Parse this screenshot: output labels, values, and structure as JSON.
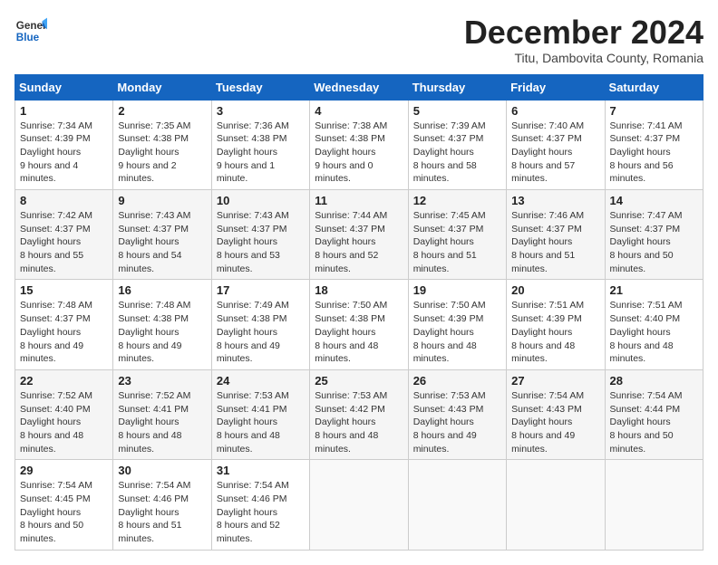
{
  "header": {
    "logo_line1": "General",
    "logo_line2": "Blue",
    "month": "December 2024",
    "location": "Titu, Dambovita County, Romania"
  },
  "columns": [
    "Sunday",
    "Monday",
    "Tuesday",
    "Wednesday",
    "Thursday",
    "Friday",
    "Saturday"
  ],
  "weeks": [
    [
      {
        "day": "1",
        "sunrise": "7:34 AM",
        "sunset": "4:39 PM",
        "daylight": "9 hours and 4 minutes."
      },
      {
        "day": "2",
        "sunrise": "7:35 AM",
        "sunset": "4:38 PM",
        "daylight": "9 hours and 2 minutes."
      },
      {
        "day": "3",
        "sunrise": "7:36 AM",
        "sunset": "4:38 PM",
        "daylight": "9 hours and 1 minute."
      },
      {
        "day": "4",
        "sunrise": "7:38 AM",
        "sunset": "4:38 PM",
        "daylight": "9 hours and 0 minutes."
      },
      {
        "day": "5",
        "sunrise": "7:39 AM",
        "sunset": "4:37 PM",
        "daylight": "8 hours and 58 minutes."
      },
      {
        "day": "6",
        "sunrise": "7:40 AM",
        "sunset": "4:37 PM",
        "daylight": "8 hours and 57 minutes."
      },
      {
        "day": "7",
        "sunrise": "7:41 AM",
        "sunset": "4:37 PM",
        "daylight": "8 hours and 56 minutes."
      }
    ],
    [
      {
        "day": "8",
        "sunrise": "7:42 AM",
        "sunset": "4:37 PM",
        "daylight": "8 hours and 55 minutes."
      },
      {
        "day": "9",
        "sunrise": "7:43 AM",
        "sunset": "4:37 PM",
        "daylight": "8 hours and 54 minutes."
      },
      {
        "day": "10",
        "sunrise": "7:43 AM",
        "sunset": "4:37 PM",
        "daylight": "8 hours and 53 minutes."
      },
      {
        "day": "11",
        "sunrise": "7:44 AM",
        "sunset": "4:37 PM",
        "daylight": "8 hours and 52 minutes."
      },
      {
        "day": "12",
        "sunrise": "7:45 AM",
        "sunset": "4:37 PM",
        "daylight": "8 hours and 51 minutes."
      },
      {
        "day": "13",
        "sunrise": "7:46 AM",
        "sunset": "4:37 PM",
        "daylight": "8 hours and 51 minutes."
      },
      {
        "day": "14",
        "sunrise": "7:47 AM",
        "sunset": "4:37 PM",
        "daylight": "8 hours and 50 minutes."
      }
    ],
    [
      {
        "day": "15",
        "sunrise": "7:48 AM",
        "sunset": "4:37 PM",
        "daylight": "8 hours and 49 minutes."
      },
      {
        "day": "16",
        "sunrise": "7:48 AM",
        "sunset": "4:38 PM",
        "daylight": "8 hours and 49 minutes."
      },
      {
        "day": "17",
        "sunrise": "7:49 AM",
        "sunset": "4:38 PM",
        "daylight": "8 hours and 49 minutes."
      },
      {
        "day": "18",
        "sunrise": "7:50 AM",
        "sunset": "4:38 PM",
        "daylight": "8 hours and 48 minutes."
      },
      {
        "day": "19",
        "sunrise": "7:50 AM",
        "sunset": "4:39 PM",
        "daylight": "8 hours and 48 minutes."
      },
      {
        "day": "20",
        "sunrise": "7:51 AM",
        "sunset": "4:39 PM",
        "daylight": "8 hours and 48 minutes."
      },
      {
        "day": "21",
        "sunrise": "7:51 AM",
        "sunset": "4:40 PM",
        "daylight": "8 hours and 48 minutes."
      }
    ],
    [
      {
        "day": "22",
        "sunrise": "7:52 AM",
        "sunset": "4:40 PM",
        "daylight": "8 hours and 48 minutes."
      },
      {
        "day": "23",
        "sunrise": "7:52 AM",
        "sunset": "4:41 PM",
        "daylight": "8 hours and 48 minutes."
      },
      {
        "day": "24",
        "sunrise": "7:53 AM",
        "sunset": "4:41 PM",
        "daylight": "8 hours and 48 minutes."
      },
      {
        "day": "25",
        "sunrise": "7:53 AM",
        "sunset": "4:42 PM",
        "daylight": "8 hours and 48 minutes."
      },
      {
        "day": "26",
        "sunrise": "7:53 AM",
        "sunset": "4:43 PM",
        "daylight": "8 hours and 49 minutes."
      },
      {
        "day": "27",
        "sunrise": "7:54 AM",
        "sunset": "4:43 PM",
        "daylight": "8 hours and 49 minutes."
      },
      {
        "day": "28",
        "sunrise": "7:54 AM",
        "sunset": "4:44 PM",
        "daylight": "8 hours and 50 minutes."
      }
    ],
    [
      {
        "day": "29",
        "sunrise": "7:54 AM",
        "sunset": "4:45 PM",
        "daylight": "8 hours and 50 minutes."
      },
      {
        "day": "30",
        "sunrise": "7:54 AM",
        "sunset": "4:46 PM",
        "daylight": "8 hours and 51 minutes."
      },
      {
        "day": "31",
        "sunrise": "7:54 AM",
        "sunset": "4:46 PM",
        "daylight": "8 hours and 52 minutes."
      },
      null,
      null,
      null,
      null
    ]
  ]
}
